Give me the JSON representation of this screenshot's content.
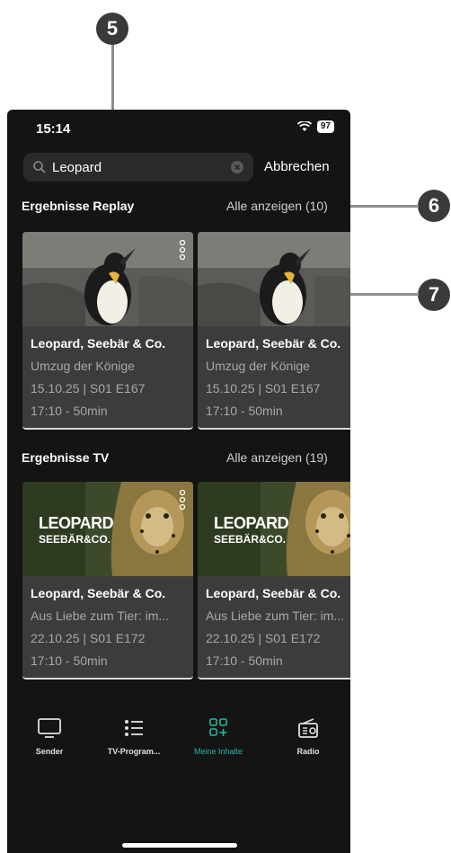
{
  "annotations": {
    "five": "5",
    "six": "6",
    "seven": "7"
  },
  "status_bar": {
    "time": "15:14",
    "battery": "97"
  },
  "search": {
    "value": "Leopard",
    "cancel_label": "Abbrechen"
  },
  "replay_section": {
    "title": "Ergebnisse Replay",
    "show_all": "Alle anzeigen (10)",
    "cards": [
      {
        "title": "Leopard, Seebär & Co.",
        "subtitle": "Umzug der Könige",
        "episode": "15.10.25 | S01 E167",
        "time": "17:10 - 50min"
      },
      {
        "title": "Leopard, Seebär & Co.",
        "subtitle": "Umzug der Könige",
        "episode": "15.10.25 | S01 E167",
        "time": "17:10 - 50min"
      }
    ]
  },
  "tv_section": {
    "title": "Ergebnisse TV",
    "show_all": "Alle anzeigen (19)",
    "cards": [
      {
        "title": "Leopard, Seebär & Co.",
        "subtitle": "Aus Liebe zum Tier: im...",
        "episode": "22.10.25 | S01 E172",
        "time": "17:10 - 50min",
        "thumb_text_1": "LEOPARD",
        "thumb_text_2": "SEEBÄR&CO."
      },
      {
        "title": "Leopard, Seebär & Co.",
        "subtitle": "Aus Liebe zum Tier: im...",
        "episode": "22.10.25 | S01 E172",
        "time": "17:10 - 50min",
        "thumb_text_1": "LEOPARD",
        "thumb_text_2": "SEEBÄR&CO."
      }
    ]
  },
  "bottom_nav": {
    "items": [
      {
        "label": "Sender",
        "icon": "tv-icon"
      },
      {
        "label": "TV-Program...",
        "icon": "list-icon"
      },
      {
        "label": "Meine Inhalte",
        "icon": "grid-plus-icon",
        "active": true
      },
      {
        "label": "Radio",
        "icon": "radio-icon"
      }
    ]
  },
  "colors": {
    "accent": "#28b5a0",
    "background": "#141414",
    "card": "#3c3c3c"
  }
}
